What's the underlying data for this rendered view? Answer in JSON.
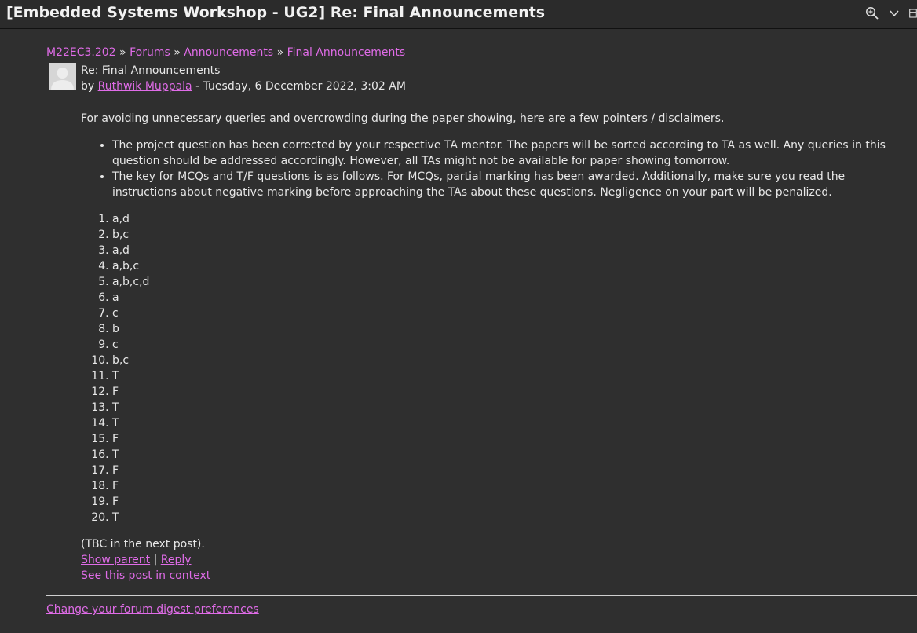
{
  "window": {
    "title": "[Embedded Systems Workshop - UG2] Re: Final Announcements"
  },
  "toolbar": {
    "icons": [
      "zoom-icon",
      "chevron-down-icon",
      "panel-icon"
    ]
  },
  "breadcrumb": {
    "items": [
      "M22EC3.202",
      "Forums",
      "Announcements",
      "Final Announcements"
    ],
    "separator": "»"
  },
  "post": {
    "subject": "Re: Final Announcements",
    "by_label": "by",
    "author": "Ruthwik Muppala",
    "date_sep": "-",
    "date": "Tuesday, 6 December 2022, 3:02 AM",
    "intro": "For avoiding unnecessary queries and overcrowding during the paper showing, here are a few pointers / disclaimers.",
    "bullets": [
      "The project question has been corrected by your respective TA mentor. The papers will be sorted according to TA as well. Any queries in this question should be addressed accordingly. However, all TAs might not be available for paper showing tomorrow.",
      "The key for MCQs and T/F questions is as follows. For MCQs, partial marking has been awarded. Additionally, make sure you read the instructions about negative marking before approaching the TAs about these questions. Negligence on your part will be penalized."
    ],
    "answers": [
      "a,d",
      "b,c",
      "a,d",
      "a,b,c",
      "a,b,c,d",
      "a",
      "c",
      "b",
      "c",
      "b,c",
      "T",
      "F",
      "T",
      "T",
      "F",
      "T",
      "F",
      "F",
      "F",
      "T"
    ],
    "footer_note": "(TBC in the next post).",
    "show_parent": "Show parent",
    "link_sep": "|",
    "reply": "Reply",
    "see_in_context": "See this post in context"
  },
  "digest_link": "Change your forum digest preferences",
  "colors": {
    "background": "#2f2f2f",
    "link": "#e06ce8",
    "text": "#e8e8e8"
  }
}
